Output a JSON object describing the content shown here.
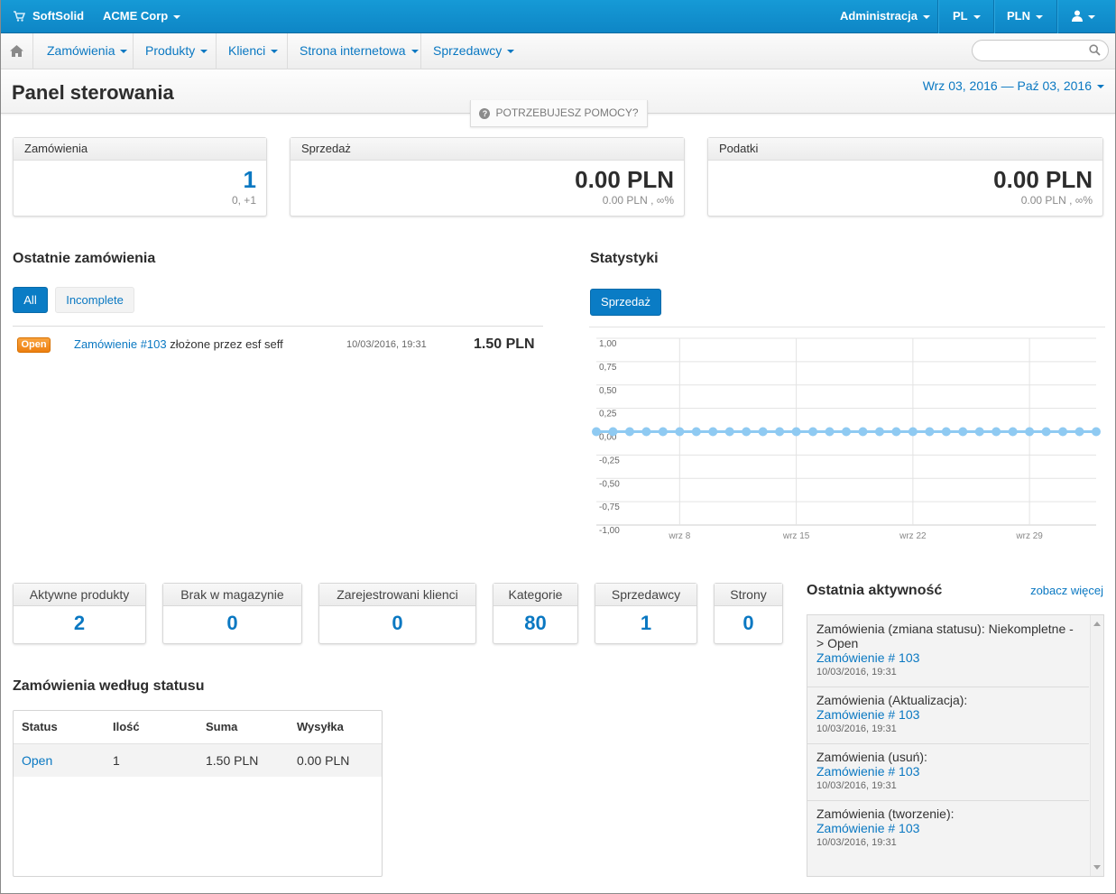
{
  "topbar": {
    "brand": "SoftSolid",
    "company": "ACME Corp",
    "admin": "Administracja",
    "language": "PL",
    "currency": "PLN"
  },
  "nav": {
    "items": [
      "Zamówienia",
      "Produkty",
      "Klienci",
      "Strona internetowa",
      "Sprzedawcy"
    ],
    "search_placeholder": ""
  },
  "header": {
    "title": "Panel sterowania",
    "date_range": "Wrz 03, 2016 — Paź 03, 2016",
    "help": "POTRZEBUJESZ POMOCY?"
  },
  "summary": [
    {
      "label": "Zamówienia",
      "value": "1",
      "sub": "0, +1",
      "color": "#0a78c2"
    },
    {
      "label": "Sprzedaż",
      "value": "0.00 PLN",
      "sub": "0.00 PLN , ∞%",
      "color": "#2d2d2d"
    },
    {
      "label": "Podatki",
      "value": "0.00 PLN",
      "sub": "0.00 PLN , ∞%",
      "color": "#2d2d2d"
    }
  ],
  "recent_orders": {
    "title": "Ostatnie zamówienia",
    "tabs": [
      "All",
      "Incomplete"
    ],
    "active_tab": "All",
    "rows": [
      {
        "status": "Open",
        "link": "Zamówienie #103",
        "text": "złożone przez esf seff",
        "date": "10/03/2016, 19:31",
        "amount": "1.50 PLN"
      }
    ]
  },
  "statistics": {
    "title": "Statystyki",
    "button": "Sprzedaż"
  },
  "chart_data": {
    "type": "line",
    "title": "",
    "xlabel": "",
    "ylabel": "",
    "y_ticks": [
      "1,00",
      "0,75",
      "0,50",
      "0,25",
      "0,00",
      "-0,25",
      "-0,50",
      "-0,75",
      "-1,00"
    ],
    "x_ticks": [
      "wrz 8",
      "wrz 15",
      "wrz 22",
      "wrz 29"
    ],
    "ylim": [
      -1,
      1
    ],
    "grid": true,
    "series": [
      {
        "color": "#8fcaf2",
        "x": [
          "2016-09-03",
          "2016-09-04",
          "2016-09-05",
          "2016-09-06",
          "2016-09-07",
          "2016-09-08",
          "2016-09-09",
          "2016-09-10",
          "2016-09-11",
          "2016-09-12",
          "2016-09-13",
          "2016-09-14",
          "2016-09-15",
          "2016-09-16",
          "2016-09-17",
          "2016-09-18",
          "2016-09-19",
          "2016-09-20",
          "2016-09-21",
          "2016-09-22",
          "2016-09-23",
          "2016-09-24",
          "2016-09-25",
          "2016-09-26",
          "2016-09-27",
          "2016-09-28",
          "2016-09-29",
          "2016-09-30",
          "2016-10-01",
          "2016-10-02",
          "2016-10-03"
        ],
        "values": [
          0,
          0,
          0,
          0,
          0,
          0,
          0,
          0,
          0,
          0,
          0,
          0,
          0,
          0,
          0,
          0,
          0,
          0,
          0,
          0,
          0,
          0,
          0,
          0,
          0,
          0,
          0,
          0,
          0,
          0,
          0
        ]
      }
    ]
  },
  "tiles": [
    {
      "label": "Aktywne produkty",
      "value": "2"
    },
    {
      "label": "Brak w magazynie",
      "value": "0"
    },
    {
      "label": "Zarejestrowani klienci",
      "value": "0"
    },
    {
      "label": "Kategorie",
      "value": "80"
    },
    {
      "label": "Sprzedawcy",
      "value": "1"
    },
    {
      "label": "Strony",
      "value": "0"
    }
  ],
  "orders_by_status": {
    "title": "Zamówienia według statusu",
    "headers": [
      "Status",
      "Ilość",
      "Suma",
      "Wysyłka"
    ],
    "rows": [
      {
        "status": "Open",
        "count": "1",
        "sum": "1.50 PLN",
        "shipping": "0.00 PLN"
      }
    ]
  },
  "activity": {
    "title": "Ostatnia aktywność",
    "more": "zobacz więcej",
    "items": [
      {
        "text": "Zamówienia (zmiana statusu): Niekompletne -> Open",
        "link": "Zamówienie # 103",
        "date": "10/03/2016, 19:31"
      },
      {
        "text": "Zamówienia (Aktualizacja):",
        "link": "Zamówienie # 103",
        "date": "10/03/2016, 19:31"
      },
      {
        "text": "Zamówienia (usuń):",
        "link": "Zamówienie # 103",
        "date": "10/03/2016, 19:31"
      },
      {
        "text": "Zamówienia (tworzenie):",
        "link": "Zamówienie # 103",
        "date": "10/03/2016, 19:31"
      }
    ]
  }
}
